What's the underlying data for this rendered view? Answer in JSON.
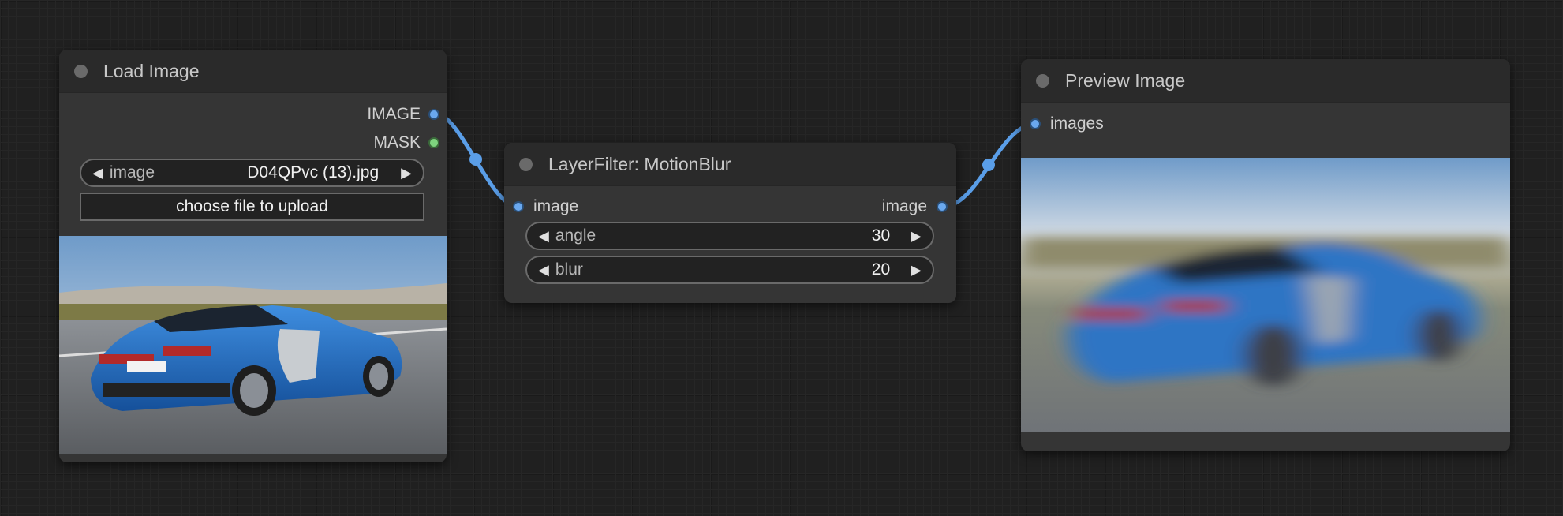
{
  "nodes": {
    "load_image": {
      "title": "Load Image",
      "outputs": [
        "IMAGE",
        "MASK"
      ],
      "image_widget": {
        "label": "image",
        "value": "D04QPvc (13).jpg"
      },
      "upload_label": "choose file to upload"
    },
    "motion_blur": {
      "title": "LayerFilter: MotionBlur",
      "input": "image",
      "output": "image",
      "widgets": [
        {
          "label": "angle",
          "value": "30"
        },
        {
          "label": "blur",
          "value": "20"
        }
      ]
    },
    "preview_image": {
      "title": "Preview Image",
      "input": "images"
    }
  },
  "icons": {
    "widget_left": "triangle-left-icon",
    "widget_right": "triangle-right-icon",
    "title_dot": "node-status-dot-icon"
  },
  "colors": {
    "image_slot": "#6aa8ee",
    "mask_slot": "#7fd37f",
    "link": "#5a9ee8",
    "canvas": "#202020",
    "node_body": "#353535",
    "node_title": "#2a2a2a"
  }
}
